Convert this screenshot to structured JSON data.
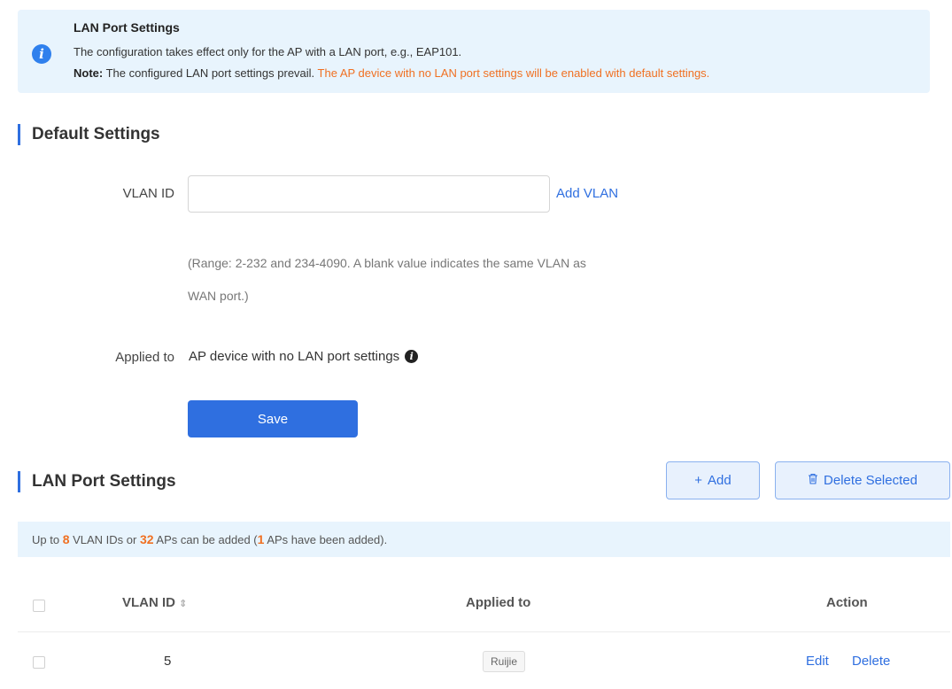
{
  "info": {
    "title": "LAN Port Settings",
    "line1": "The configuration takes effect only for the AP with a LAN port, e.g., EAP101.",
    "note_label": "Note:",
    "note_text": " The configured LAN port settings prevail. ",
    "note_warning": "The AP device with no LAN port settings will be enabled with default settings."
  },
  "default_settings": {
    "title": "Default Settings",
    "vlan_label": "VLAN ID",
    "vlan_value": "",
    "add_vlan_link": "Add VLAN",
    "hint_line1": "(Range: 2-232 and 234-4090. A blank value indicates the same VLAN as",
    "hint_line2": "WAN port.)",
    "applied_label": "Applied to",
    "applied_value": "AP device with no LAN port settings",
    "save_label": "Save"
  },
  "lan_settings": {
    "title": "LAN Port Settings",
    "add_label": "Add",
    "delete_selected_label": "Delete Selected",
    "limit": {
      "prefix": "Up to ",
      "vlan_max": "8",
      "mid1": " VLAN IDs or ",
      "ap_max": "32",
      "mid2": " APs can be added (",
      "ap_added": "1",
      "suffix": " APs have been added)."
    },
    "columns": [
      "VLAN ID",
      "Applied to",
      "Action"
    ],
    "rows": [
      {
        "vlan_id": "5",
        "applied_to": "Ruijie",
        "edit": "Edit",
        "delete": "Delete"
      }
    ]
  },
  "colors": {
    "accent": "#2f6fe0",
    "warning": "#f07022",
    "info_bg": "#e8f4fd"
  },
  "icons": [
    "info-icon",
    "plus-icon",
    "trash-icon",
    "sort-icon",
    "info-dot-icon"
  ]
}
